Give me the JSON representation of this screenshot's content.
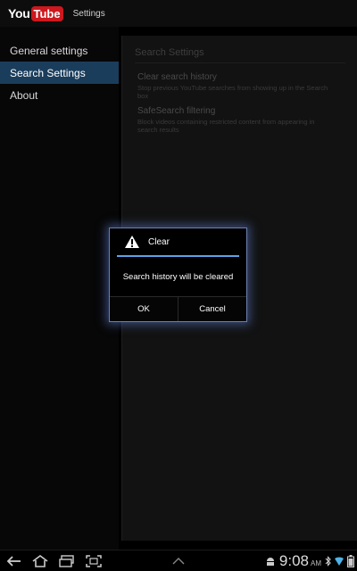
{
  "action_bar": {
    "logo_you": "You",
    "logo_tube": "Tube",
    "title": "Settings"
  },
  "sidebar": {
    "items": [
      {
        "label": "General settings",
        "active": false
      },
      {
        "label": "Search Settings",
        "active": true
      },
      {
        "label": "About",
        "active": false
      }
    ]
  },
  "search_settings": {
    "header": "Search Settings",
    "prefs": [
      {
        "title": "Clear search history",
        "summary": "Stop previous YouTube searches from showing up in the Search box"
      },
      {
        "title": "SafeSearch filtering",
        "summary": "Block videos containing restricted content from appearing in search results"
      }
    ]
  },
  "dialog": {
    "title": "Clear",
    "message": "Search history will be cleared",
    "ok_label": "OK",
    "cancel_label": "Cancel",
    "icon": "warning-icon",
    "accent_color": "#5aa3ea"
  },
  "system_bar": {
    "time": "9:08",
    "ampm": "AM",
    "icons": [
      "back-icon",
      "home-icon",
      "recent-apps-icon",
      "screenshot-icon",
      "menu-up-icon",
      "android-icon",
      "bluetooth-icon",
      "wifi-icon",
      "battery-icon"
    ]
  }
}
